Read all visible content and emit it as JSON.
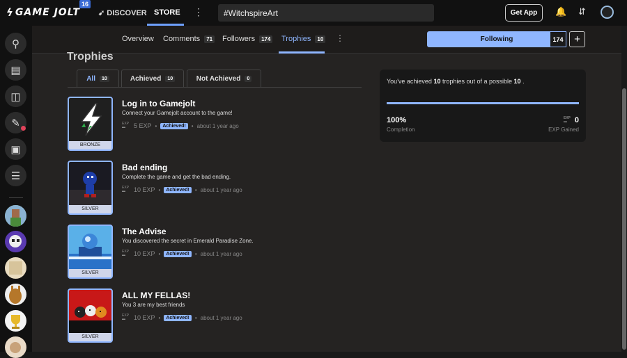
{
  "topbar": {
    "version": "16",
    "discover": "DISCOVER",
    "store": "STORE",
    "search_value": "#WitchspireArt",
    "get_app": "Get App",
    "logo_text": "GAME JOLT"
  },
  "tabs": [
    {
      "label": "Overview",
      "count": ""
    },
    {
      "label": "Comments",
      "count": "71"
    },
    {
      "label": "Followers",
      "count": "174"
    },
    {
      "label": "Trophies",
      "count": "10"
    }
  ],
  "following": {
    "label": "Following",
    "count": "174"
  },
  "heading": "Trophies",
  "filter_tabs": [
    {
      "label": "All",
      "count": "10"
    },
    {
      "label": "Achieved",
      "count": "10"
    },
    {
      "label": "Not Achieved",
      "count": "0"
    }
  ],
  "trophies": [
    {
      "title": "Log in to Gamejolt",
      "desc": "Connect your Gamejolt account to the game!",
      "exp": "5 EXP",
      "status": "Achieved!",
      "time": "about 1 year ago",
      "tier": "BRONZE"
    },
    {
      "title": "Bad ending",
      "desc": "Complete the game and get the bad ending.",
      "exp": "10 EXP",
      "status": "Achieved!",
      "time": "about 1 year ago",
      "tier": "SILVER"
    },
    {
      "title": "The Advise",
      "desc": "You discovered the secret in Emerald Paradise Zone.",
      "exp": "10 EXP",
      "status": "Achieved!",
      "time": "about 1 year ago",
      "tier": "SILVER"
    },
    {
      "title": "ALL MY FELLAS!",
      "desc": "You 3 are my best friends",
      "exp": "10 EXP",
      "status": "Achieved!",
      "time": "about 1 year ago",
      "tier": "SILVER"
    }
  ],
  "summary": {
    "pre": "You've achieved ",
    "achieved": "10",
    "mid": " trophies out of a possible ",
    "possible": "10",
    "post": " .",
    "percent": "100%",
    "completion_label": "Completion",
    "exp": "0",
    "exp_label": "EXP Gained",
    "progress_fraction": 1.0
  },
  "colors": {
    "accent": "#8fb6ff",
    "background": "#252322",
    "topbar": "#111111"
  }
}
